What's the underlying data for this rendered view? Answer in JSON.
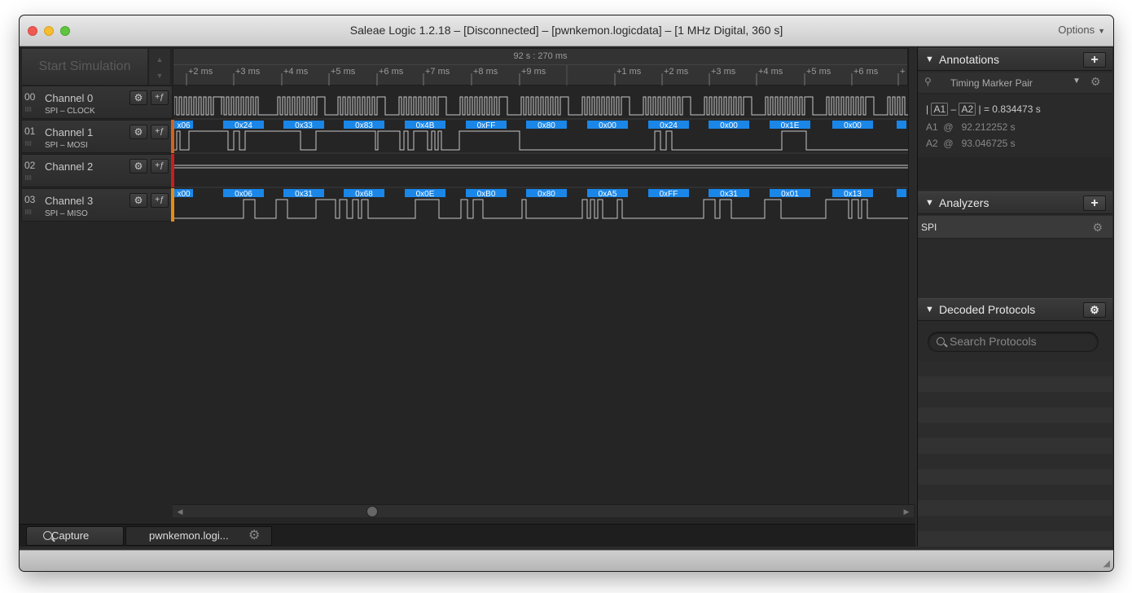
{
  "window": {
    "title": "Saleae Logic 1.2.18 – [Disconnected] – [pwnkemon.logicdata] – [1 MHz Digital, 360 s]",
    "options_label": "Options"
  },
  "toolbar": {
    "start_simulation_label": "Start Simulation"
  },
  "timeline": {
    "center_time": "92 s : 270 ms",
    "ticks": [
      "+2 ms",
      "+3 ms",
      "+4 ms",
      "+5 ms",
      "+6 ms",
      "+7 ms",
      "+8 ms",
      "+9 ms",
      "+1 ms",
      "+2 ms",
      "+3 ms",
      "+4 ms",
      "+5 ms",
      "+6 ms",
      "+"
    ]
  },
  "channels": [
    {
      "num": "00",
      "name": "Channel 0",
      "sub": "SPI – CLOCK",
      "bar_color": ""
    },
    {
      "num": "01",
      "name": "Channel 1",
      "sub": "SPI – MOSI",
      "bar_color": "#d2641e"
    },
    {
      "num": "02",
      "name": "Channel 2",
      "sub": "",
      "bar_color": "#c81e1e"
    },
    {
      "num": "03",
      "name": "Channel 3",
      "sub": "SPI – MISO",
      "bar_color": "#e68c14"
    }
  ],
  "mosi_bytes": [
    "x06",
    "0x24",
    "0x33",
    "0x83",
    "0x4B",
    "0xFF",
    "0x80",
    "0x00",
    "0x24",
    "0x00",
    "0x1E",
    "0x00",
    ""
  ],
  "miso_bytes": [
    "x00",
    "0x06",
    "0x31",
    "0x68",
    "0x0E",
    "0xB0",
    "0x80",
    "0xA5",
    "0xFF",
    "0x31",
    "0x01",
    "0x13",
    ""
  ],
  "colors": {
    "decode_blue": "#1a86e8",
    "wave_line": "#c8c8c8"
  },
  "tabs": {
    "capture_label": "Capture",
    "file_label": "pwnkemon.logi..."
  },
  "annotations": {
    "title": "Annotations",
    "marker_pair_label": "Timing Marker Pair",
    "a1_label": "A1",
    "a2_label": "A2",
    "delta_value": "= 0.834473 s",
    "a1_value": "92.212252 s",
    "a2_value": "93.046725 s",
    "at_symbol": "@"
  },
  "analyzers": {
    "title": "Analyzers",
    "items": [
      {
        "label": "SPI"
      }
    ]
  },
  "decoded": {
    "title": "Decoded Protocols",
    "search_placeholder": "Search Protocols"
  }
}
